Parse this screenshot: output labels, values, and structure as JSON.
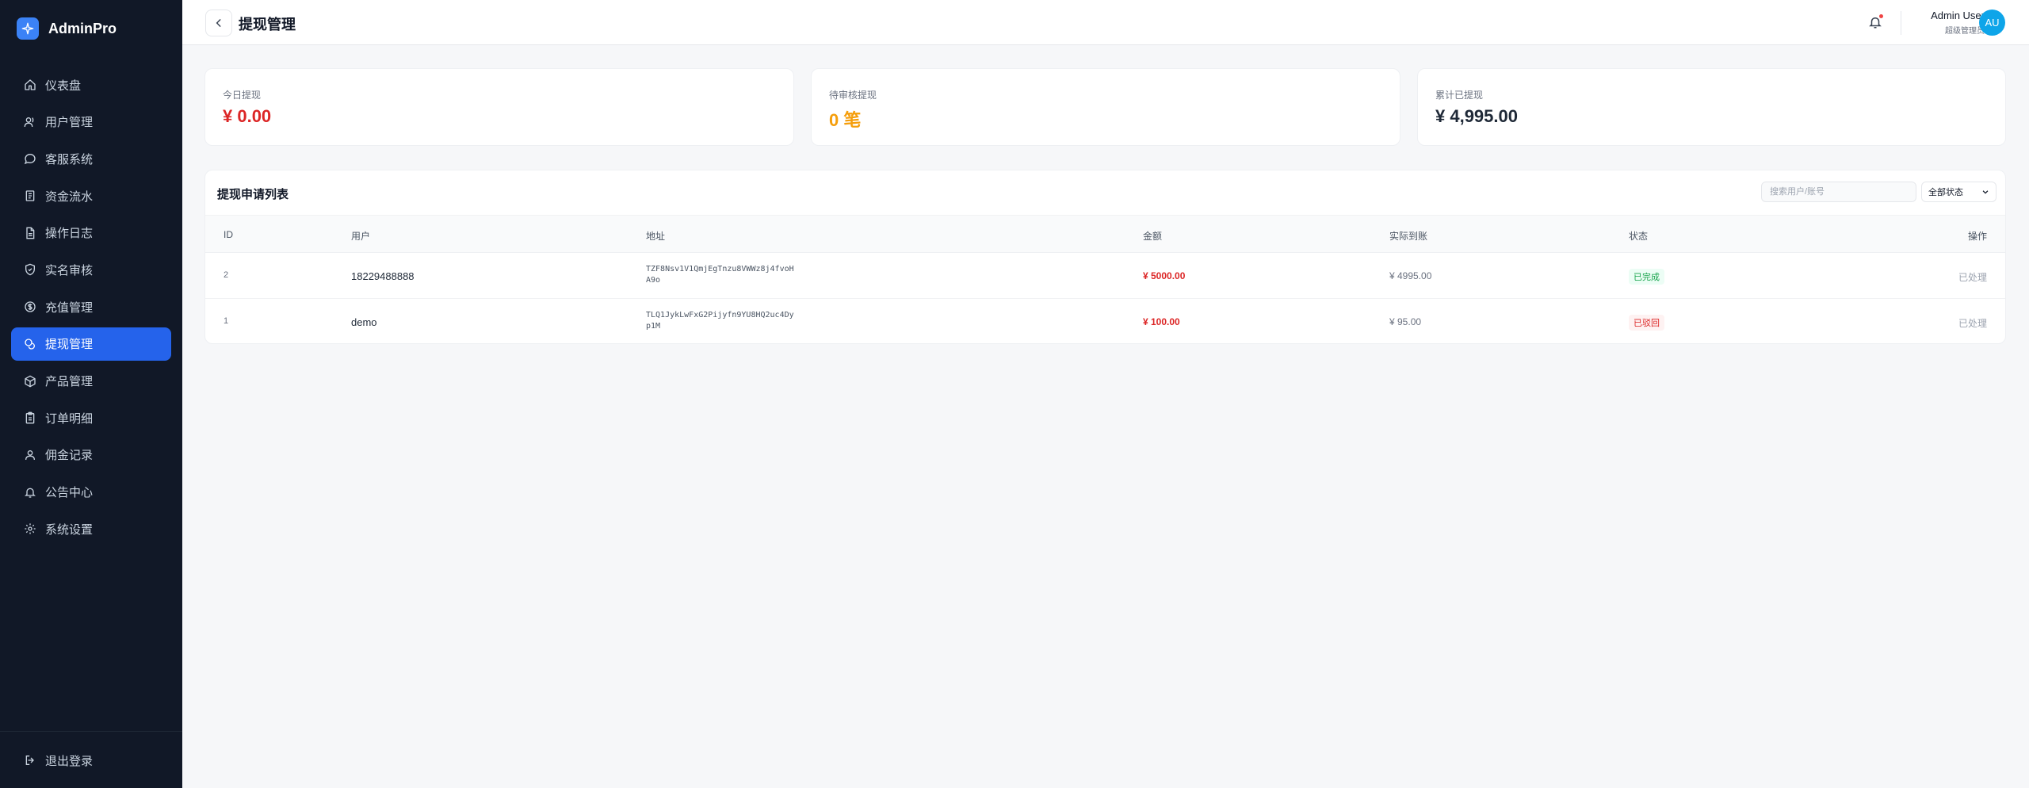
{
  "app": {
    "name": "AdminPro"
  },
  "sidebar": {
    "items": [
      {
        "label": "仪表盘",
        "icon": "home-icon",
        "active": false
      },
      {
        "label": "用户管理",
        "icon": "users-icon",
        "active": false
      },
      {
        "label": "客服系统",
        "icon": "chat-icon",
        "active": false
      },
      {
        "label": "资金流水",
        "icon": "ledger-icon",
        "active": false
      },
      {
        "label": "操作日志",
        "icon": "file-icon",
        "active": false
      },
      {
        "label": "实名审核",
        "icon": "shield-icon",
        "active": false
      },
      {
        "label": "充值管理",
        "icon": "dollar-icon",
        "active": false
      },
      {
        "label": "提现管理",
        "icon": "coins-icon",
        "active": true
      },
      {
        "label": "产品管理",
        "icon": "box-icon",
        "active": false
      },
      {
        "label": "订单明细",
        "icon": "clipboard-icon",
        "active": false
      },
      {
        "label": "佣金记录",
        "icon": "people-icon",
        "active": false
      },
      {
        "label": "公告中心",
        "icon": "bell-icon",
        "active": false
      },
      {
        "label": "系统设置",
        "icon": "gear-icon",
        "active": false
      }
    ],
    "logout_label": "退出登录"
  },
  "header": {
    "title": "提现管理",
    "user_name": "Admin User",
    "user_role": "超级管理员",
    "avatar_initials": "AU"
  },
  "stats": [
    {
      "label": "今日提现",
      "value": "¥ 0.00",
      "color": "#dc2626"
    },
    {
      "label": "待审核提现",
      "value": "0 笔",
      "color": "#f59e0b"
    },
    {
      "label": "累计已提现",
      "value": "¥ 4,995.00",
      "color": "#1f2937"
    }
  ],
  "table": {
    "title": "提现申请列表",
    "search_placeholder": "搜索用户/账号",
    "status_filter": "全部状态",
    "columns": [
      "ID",
      "用户",
      "地址",
      "金额",
      "实际到账",
      "状态",
      "操作"
    ],
    "rows": [
      {
        "id": "2",
        "user": "18229488888",
        "address": "TZF8Nsv1V1QmjEgTnzu8VWWz8j4fvoHA9o",
        "amount": "¥ 5000.00",
        "received": "¥ 4995.00",
        "status": "已完成",
        "status_type": "done",
        "action": "已处理"
      },
      {
        "id": "1",
        "user": "demo",
        "address": "TLQ1JykLwFxG2Pijyfn9YU8HQ2uc4Dyp1M",
        "amount": "¥ 100.00",
        "received": "¥ 95.00",
        "status": "已驳回",
        "status_type": "rejected",
        "action": "已处理"
      }
    ]
  },
  "colors": {
    "sidebar_bg": "#111827",
    "accent": "#2563eb",
    "danger": "#dc2626",
    "warning": "#f59e0b",
    "success": "#16a34a"
  }
}
